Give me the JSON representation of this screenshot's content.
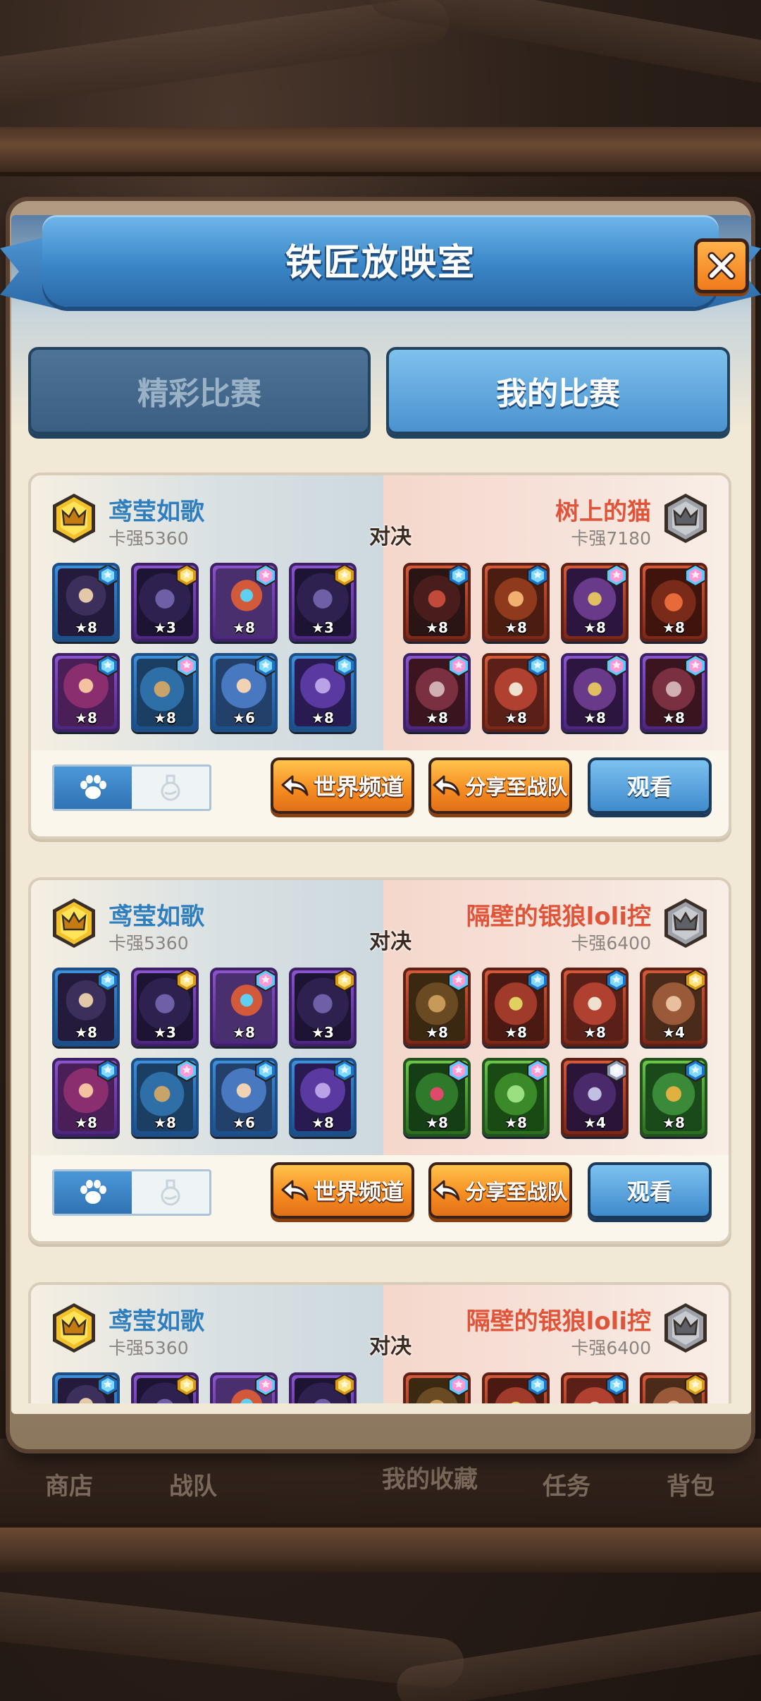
{
  "dialog": {
    "title": "铁匠放映室"
  },
  "tabs": [
    {
      "label": "精彩比赛",
      "active": false
    },
    {
      "label": "我的比赛",
      "active": true
    }
  ],
  "underlying_nav": [
    "商店",
    "战队",
    "我的收藏",
    "任务",
    "背包"
  ],
  "versus_label": "对决",
  "buttons": {
    "world_channel": "世界频道",
    "share_team": "分享至战队",
    "watch": "观看"
  },
  "matches": [
    {
      "left": {
        "name": "鸢莹如歌",
        "power": "卡强5360",
        "badge": "gold-crown",
        "cards": [
          {
            "stars": "★8",
            "rarity": "blue",
            "art": "a1",
            "gem": "blue"
          },
          {
            "stars": "★3",
            "rarity": "purple",
            "art": "a2",
            "gem": "gold"
          },
          {
            "stars": "★8",
            "rarity": "purple",
            "art": "a3",
            "gem": "rainbow"
          },
          {
            "stars": "★3",
            "rarity": "purple",
            "art": "a2",
            "gem": "gold"
          },
          {
            "stars": "★8",
            "rarity": "purple",
            "art": "a4",
            "gem": "blue"
          },
          {
            "stars": "★8",
            "rarity": "blue",
            "art": "a5",
            "gem": "rainbow"
          },
          {
            "stars": "★6",
            "rarity": "blue",
            "art": "a6",
            "gem": "blue"
          },
          {
            "stars": "★8",
            "rarity": "blue",
            "art": "a7",
            "gem": "blue"
          }
        ]
      },
      "right": {
        "name": "树上的猫",
        "power": "卡强7180",
        "badge": "silver-crown",
        "cards": [
          {
            "stars": "★8",
            "rarity": "red",
            "art": "a8",
            "gem": "blue"
          },
          {
            "stars": "★8",
            "rarity": "red",
            "art": "a9",
            "gem": "blue"
          },
          {
            "stars": "★8",
            "rarity": "red",
            "art": "a10",
            "gem": "rainbow"
          },
          {
            "stars": "★8",
            "rarity": "red",
            "art": "a11",
            "gem": "rainbow"
          },
          {
            "stars": "★8",
            "rarity": "purple",
            "art": "a12",
            "gem": "rainbow"
          },
          {
            "stars": "★8",
            "rarity": "red",
            "art": "a13",
            "gem": "blue"
          },
          {
            "stars": "★8",
            "rarity": "purple",
            "art": "a10",
            "gem": "rainbow"
          },
          {
            "stars": "★8",
            "rarity": "purple",
            "art": "a12",
            "gem": "rainbow"
          }
        ]
      }
    },
    {
      "left": {
        "name": "鸢莹如歌",
        "power": "卡强5360",
        "badge": "gold-crown",
        "cards": [
          {
            "stars": "★8",
            "rarity": "blue",
            "art": "a1",
            "gem": "blue"
          },
          {
            "stars": "★3",
            "rarity": "purple",
            "art": "a2",
            "gem": "gold"
          },
          {
            "stars": "★8",
            "rarity": "purple",
            "art": "a3",
            "gem": "rainbow"
          },
          {
            "stars": "★3",
            "rarity": "purple",
            "art": "a2",
            "gem": "gold"
          },
          {
            "stars": "★8",
            "rarity": "purple",
            "art": "a4",
            "gem": "blue"
          },
          {
            "stars": "★8",
            "rarity": "blue",
            "art": "a5",
            "gem": "rainbow"
          },
          {
            "stars": "★6",
            "rarity": "blue",
            "art": "a6",
            "gem": "blue"
          },
          {
            "stars": "★8",
            "rarity": "blue",
            "art": "a7",
            "gem": "blue"
          }
        ]
      },
      "right": {
        "name": "隔壁的银狼loli控",
        "power": "卡强6400",
        "badge": "silver-crown",
        "cards": [
          {
            "stars": "★8",
            "rarity": "red",
            "art": "a14",
            "gem": "rainbow"
          },
          {
            "stars": "★8",
            "rarity": "red",
            "art": "a15",
            "gem": "blue"
          },
          {
            "stars": "★8",
            "rarity": "red",
            "art": "a13",
            "gem": "blue"
          },
          {
            "stars": "★4",
            "rarity": "red",
            "art": "a16",
            "gem": "gold"
          },
          {
            "stars": "★8",
            "rarity": "green",
            "art": "a17",
            "gem": "rainbow"
          },
          {
            "stars": "★8",
            "rarity": "green",
            "art": "a18",
            "gem": "rainbow"
          },
          {
            "stars": "★4",
            "rarity": "red",
            "art": "a19",
            "gem": "silver"
          },
          {
            "stars": "★8",
            "rarity": "green",
            "art": "a20",
            "gem": "blue"
          }
        ]
      }
    },
    {
      "left": {
        "name": "鸢莹如歌",
        "power": "卡强5360",
        "badge": "gold-crown",
        "cards": [
          {
            "stars": "",
            "rarity": "blue",
            "art": "a1",
            "gem": "blue"
          },
          {
            "stars": "",
            "rarity": "purple",
            "art": "a2",
            "gem": "gold"
          },
          {
            "stars": "",
            "rarity": "purple",
            "art": "a3",
            "gem": "rainbow"
          },
          {
            "stars": "",
            "rarity": "purple",
            "art": "a2",
            "gem": "gold"
          }
        ]
      },
      "right": {
        "name": "隔壁的银狼loli控",
        "power": "卡强6400",
        "badge": "silver-crown",
        "cards": [
          {
            "stars": "",
            "rarity": "red",
            "art": "a14",
            "gem": "rainbow"
          },
          {
            "stars": "",
            "rarity": "red",
            "art": "a15",
            "gem": "blue"
          },
          {
            "stars": "",
            "rarity": "red",
            "art": "a13",
            "gem": "blue"
          },
          {
            "stars": "",
            "rarity": "red",
            "art": "a16",
            "gem": "gold"
          }
        ]
      }
    }
  ],
  "colors": {
    "player_left": "#2f7fbf",
    "player_right": "#e0553a",
    "button_orange": "#f58a1f",
    "button_blue": "#3f8acb"
  }
}
